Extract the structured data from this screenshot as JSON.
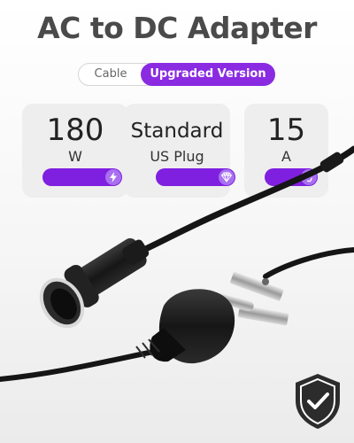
{
  "title": "AC to DC Adapter",
  "tabs": {
    "left": "Cable",
    "right": "Upgraded Version"
  },
  "specs": [
    {
      "value": "180",
      "unit": "W",
      "icon": "lightning-icon"
    },
    {
      "value": "Standard",
      "unit": "US Plug",
      "icon": "diamond-icon"
    },
    {
      "value": "15",
      "unit": "A",
      "icon": "recycle-icon"
    }
  ],
  "colors": {
    "accent": "#7f1fe0",
    "title": "#4a4a4a",
    "card": "#eeeeee"
  }
}
